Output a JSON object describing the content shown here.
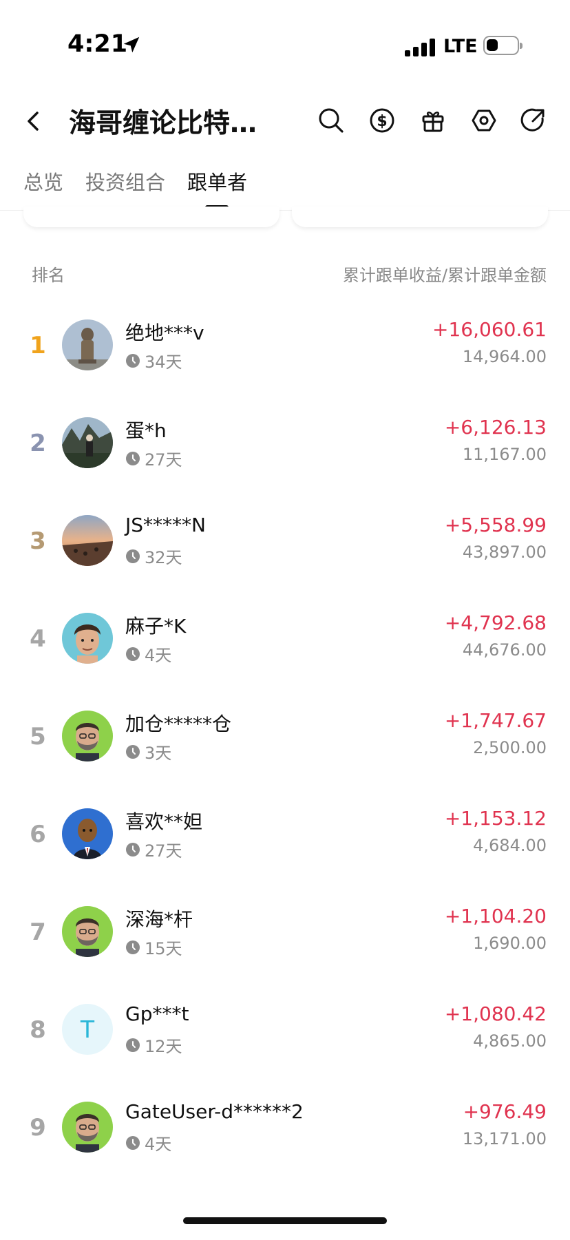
{
  "status_bar": {
    "time": "4:21",
    "network": "LTE"
  },
  "header": {
    "title": "海哥缠论比特…",
    "icons": [
      "back-icon",
      "search-icon",
      "dollar-icon",
      "gift-icon",
      "settings-icon",
      "share-icon"
    ]
  },
  "tabs": [
    {
      "label": "总览",
      "active": false
    },
    {
      "label": "投资组合",
      "active": false
    },
    {
      "label": "跟单者",
      "active": true
    }
  ],
  "list_header": {
    "left": "排名",
    "right": "累计跟单收益/累计跟单金额"
  },
  "colors": {
    "profit": "#e0334f",
    "rank_gold": "#f0a31c",
    "rank_silver": "#8a93b0",
    "rank_bronze": "#b59a73",
    "rank_default": "#a6a6a6"
  },
  "rows": [
    {
      "rank": "1",
      "name": "绝地***v",
      "days": "34天",
      "profit": "+16,060.61",
      "amount": "14,964.00",
      "avatar": "statue-photo"
    },
    {
      "rank": "2",
      "name": "蛋*h",
      "days": "27天",
      "profit": "+6,126.13",
      "amount": "11,167.00",
      "avatar": "mountain-person-photo"
    },
    {
      "rank": "3",
      "name": "JS*****N",
      "days": "32天",
      "profit": "+5,558.99",
      "amount": "43,897.00",
      "avatar": "sunset-beach-photo"
    },
    {
      "rank": "4",
      "name": "麻子*K",
      "days": "4天",
      "profit": "+4,792.68",
      "amount": "44,676.00",
      "avatar": "young-man-avatar"
    },
    {
      "rank": "5",
      "name": "加仓*****仓",
      "days": "3天",
      "profit": "+1,747.67",
      "amount": "2,500.00",
      "avatar": "bearded-man-avatar"
    },
    {
      "rank": "6",
      "name": "喜欢**妲",
      "days": "27天",
      "profit": "+1,153.12",
      "amount": "4,684.00",
      "avatar": "suited-figure-avatar"
    },
    {
      "rank": "7",
      "name": "深海*杆",
      "days": "15天",
      "profit": "+1,104.20",
      "amount": "1,690.00",
      "avatar": "bearded-man-avatar"
    },
    {
      "rank": "8",
      "name": "Gp***t",
      "days": "12天",
      "profit": "+1,080.42",
      "amount": "4,865.00",
      "avatar": "letter-avatar",
      "avatar_letter": "T"
    },
    {
      "rank": "9",
      "name": "GateUser-d******2",
      "days": "4天",
      "profit": "+976.49",
      "amount": "13,171.00",
      "avatar": "bearded-man-avatar"
    }
  ]
}
